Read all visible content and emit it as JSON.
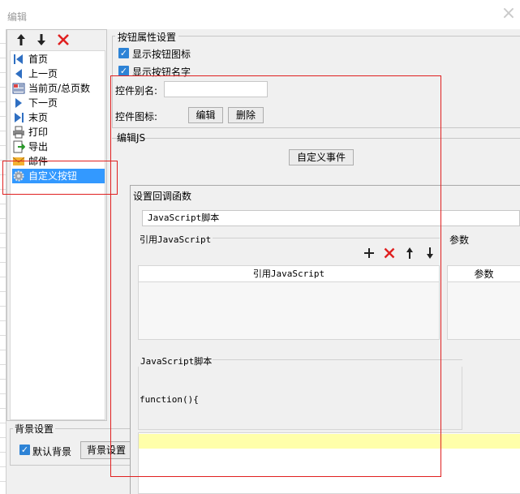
{
  "window": {
    "title": "编辑",
    "close_icon": "close-icon"
  },
  "left_panel": {
    "toolbar": [
      "up-arrow-icon",
      "down-arrow-icon",
      "delete-icon"
    ],
    "items": [
      {
        "label": "首页",
        "icon": "first-page-icon"
      },
      {
        "label": "上一页",
        "icon": "previous-page-icon"
      },
      {
        "label": "当前页/总页数",
        "icon": "page-count-icon"
      },
      {
        "label": "下一页",
        "icon": "next-page-icon"
      },
      {
        "label": "末页",
        "icon": "last-page-icon"
      },
      {
        "label": "打印",
        "icon": "print-icon"
      },
      {
        "label": "导出",
        "icon": "export-icon"
      },
      {
        "label": "邮件",
        "icon": "mail-icon"
      },
      {
        "label": "自定义按钮",
        "icon": "gear-icon",
        "selected": true
      }
    ],
    "background": {
      "legend": "背景设置",
      "default_label": "默认背景",
      "default_checked": true,
      "settings_button": "背景设置"
    }
  },
  "properties": {
    "legend": "按钮属性设置",
    "show_icon": {
      "label": "显示按钮图标",
      "checked": true
    },
    "show_name": {
      "label": "显示按钮名字",
      "checked": true
    },
    "alias_label": "控件别名:",
    "alias_value": "",
    "icon_label": "控件图标:",
    "edit_button": "编辑",
    "delete_button": "删除"
  },
  "js_section": {
    "legend": "编辑JS",
    "custom_event_button": "自定义事件"
  },
  "callback_dialog": {
    "title": "设置回调函数",
    "type_selected": "JavaScript脚本",
    "ref_label": "引用JavaScript",
    "param_label": "参数",
    "ref_toolbar": [
      "add-icon",
      "delete-icon",
      "up-arrow-icon",
      "down-arrow-icon"
    ],
    "ref_column": "引用JavaScript",
    "param_column": "参数",
    "script_label": "JavaScript脚本",
    "script_code": "function(){"
  },
  "colors": {
    "selection": "#3399ff",
    "checkbox": "#2d83d6",
    "annotation_red": "#e02020",
    "editor_highlight": "#ffffaa"
  }
}
